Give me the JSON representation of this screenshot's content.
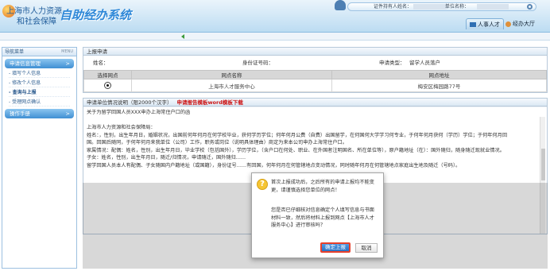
{
  "header": {
    "logo_line1": "上海市人力资源",
    "logo_line2": "和社会保障",
    "system_title": "自助经办系统",
    "user_info_label": "证件持有人姓名：",
    "unit_label": "单位名称：",
    "nav": [
      {
        "label": "人事人才",
        "icon": "person-icon"
      },
      {
        "label": "经办大厅",
        "icon": "hall-icon"
      }
    ]
  },
  "sidebar": {
    "title": "导航菜单",
    "menu_label": "MENU",
    "sections": [
      {
        "label": "申请信息管理",
        "arrow": ">"
      },
      {
        "label": "操作手册",
        "arrow": ">"
      }
    ],
    "items": [
      "- 填写个人信息",
      "- 修改个人信息",
      "- 查询与上报",
      "- 受理网点确认"
    ]
  },
  "application": {
    "panel_title": "上报申请",
    "name_label": "姓名：",
    "id_label": "身份证号码：",
    "type_label": "申请类型：",
    "type_value": "留学人员落户",
    "table_headers": [
      "选择网点",
      "网点名称",
      "网点地址"
    ],
    "rows": [
      {
        "name": "上海市人才服务中心",
        "address": "梅安区梅园路77号"
      }
    ]
  },
  "reason": {
    "title": "申请单位情况说明（限2000个汉字）",
    "template_link": "申请报告模板word模板下载",
    "lines": [
      "关于为留学回国人员XXX申办上海常住户口的函",
      "",
      "上海市人力资源和社会保障局：",
      "姓名：，性别，出生年月日，婚姻状况，出国前何年何月在何学校毕业，获何学历学位；何年何月公费（自费）出国留学，在何国何大学学习何专业，于何年何月获何（学历）学位；于何年何月回",
      "国。回国后随同，于何年何月来我单位（公司）工作，职务或岗位（说明具体理由）商定为来本公司申办上海常住户口。",
      "家属情况：配偶：姓名，性别，出生年月日，毕业学校（包括国外），学历学位，（含户口在何处、职业、在外国者注明国名、所在单位等），原户籍地址（在）：国外随归，随身随迁现就业情况。",
      "子女：姓名，性别，出生年月日，随迁/归情况，申请随迁，国外随归……",
      "留学回国人员本人有配偶、子女随国内户籍地址（或国籍），身份证号……有回国，何年何月在何管辖地点变动情况，同时随年何月在何管辖地点家庭出生地及随迁（号码）。"
    ]
  },
  "dialog": {
    "message1": "首次上报成功后，之后所有的申请上报均不能变更，请谨慎选择您单位的网点！",
    "message2": "您是否已仔细核对信息确定个人填写信息与书面材料一致，然后将材料上报到网点【上海市人才服务中心】进行审核吗？",
    "ok_label": "确定上报",
    "cancel_label": "取消"
  }
}
